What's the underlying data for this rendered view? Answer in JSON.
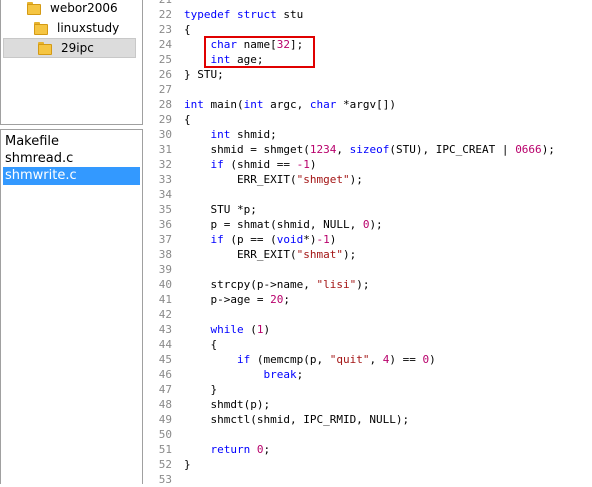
{
  "folder_tree": {
    "items": [
      {
        "label": "webor2006",
        "selected": false
      },
      {
        "label": "linuxstudy",
        "selected": false
      },
      {
        "label": "29ipc",
        "selected": true
      }
    ]
  },
  "file_list": {
    "items": [
      {
        "label": "Makefile",
        "selected": false
      },
      {
        "label": "shmread.c",
        "selected": false
      },
      {
        "label": "shmwrite.c",
        "selected": true
      }
    ]
  },
  "editor": {
    "highlight_color": "#e00000",
    "lines": [
      {
        "n": "21",
        "code": ""
      },
      {
        "n": "22",
        "code": "typedef struct stu"
      },
      {
        "n": "23",
        "code": "{"
      },
      {
        "n": "24",
        "code": "    char name[32];"
      },
      {
        "n": "25",
        "code": "    int age;"
      },
      {
        "n": "26",
        "code": "} STU;"
      },
      {
        "n": "27",
        "code": ""
      },
      {
        "n": "28",
        "code": "int main(int argc, char *argv[])"
      },
      {
        "n": "29",
        "code": "{"
      },
      {
        "n": "30",
        "code": "    int shmid;"
      },
      {
        "n": "31",
        "code": "    shmid = shmget(1234, sizeof(STU), IPC_CREAT | 0666);"
      },
      {
        "n": "32",
        "code": "    if (shmid == -1)"
      },
      {
        "n": "33",
        "code": "        ERR_EXIT(\"shmget\");"
      },
      {
        "n": "34",
        "code": ""
      },
      {
        "n": "35",
        "code": "    STU *p;"
      },
      {
        "n": "36",
        "code": "    p = shmat(shmid, NULL, 0);"
      },
      {
        "n": "37",
        "code": "    if (p == (void*)-1)"
      },
      {
        "n": "38",
        "code": "        ERR_EXIT(\"shmat\");"
      },
      {
        "n": "39",
        "code": ""
      },
      {
        "n": "40",
        "code": "    strcpy(p->name, \"lisi\");"
      },
      {
        "n": "41",
        "code": "    p->age = 20;"
      },
      {
        "n": "42",
        "code": ""
      },
      {
        "n": "43",
        "code": "    while (1)"
      },
      {
        "n": "44",
        "code": "    {"
      },
      {
        "n": "45",
        "code": "        if (memcmp(p, \"quit\", 4) == 0)"
      },
      {
        "n": "46",
        "code": "            break;"
      },
      {
        "n": "47",
        "code": "    }"
      },
      {
        "n": "48",
        "code": "    shmdt(p);"
      },
      {
        "n": "49",
        "code": "    shmctl(shmid, IPC_RMID, NULL);"
      },
      {
        "n": "50",
        "code": ""
      },
      {
        "n": "51",
        "code": "    return 0;"
      },
      {
        "n": "52",
        "code": "}"
      },
      {
        "n": "53",
        "code": ""
      }
    ]
  }
}
